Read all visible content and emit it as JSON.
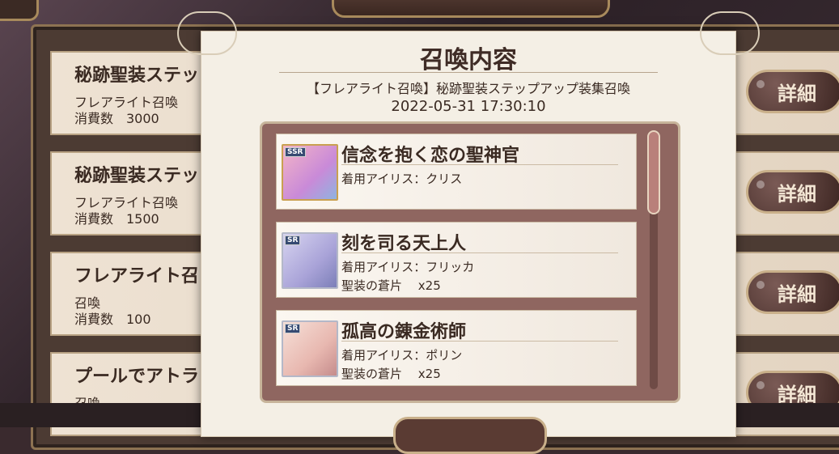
{
  "history": {
    "rows": [
      {
        "title": "秘跡聖装ステッ",
        "line1": "フレアライト召喚",
        "line2": "消費数　3000"
      },
      {
        "title": "秘跡聖装ステッ",
        "line1": "フレアライト召喚",
        "line2": "消費数　1500"
      },
      {
        "title": "フレアライト召",
        "line1": "召喚",
        "line2": "消費数　100"
      },
      {
        "title": "プールでアトラ",
        "line1": "召喚",
        "line2": ""
      }
    ],
    "detail_label": "詳細"
  },
  "modal": {
    "title": "召喚内容",
    "gacha_name": "【フレアライト召喚】秘跡聖装ステップアップ装集召喚",
    "date": "2022-05-31 17:30:10",
    "items": [
      {
        "rarity": "SSR",
        "name": "信念を抱く恋の聖神官",
        "sub1": "着用アイリス：クリス",
        "sub2": ""
      },
      {
        "rarity": "SR",
        "name": "刻を司る天上人",
        "sub1": "着用アイリス：フリッカ",
        "sub2": "聖装の蒼片　 x25"
      },
      {
        "rarity": "SR",
        "name": "孤高の錬金術師",
        "sub1": "着用アイリス：ポリン",
        "sub2": "聖装の蒼片　 x25"
      }
    ]
  },
  "colors": {
    "accent": "#8f6660",
    "gold": "#c9a050"
  }
}
